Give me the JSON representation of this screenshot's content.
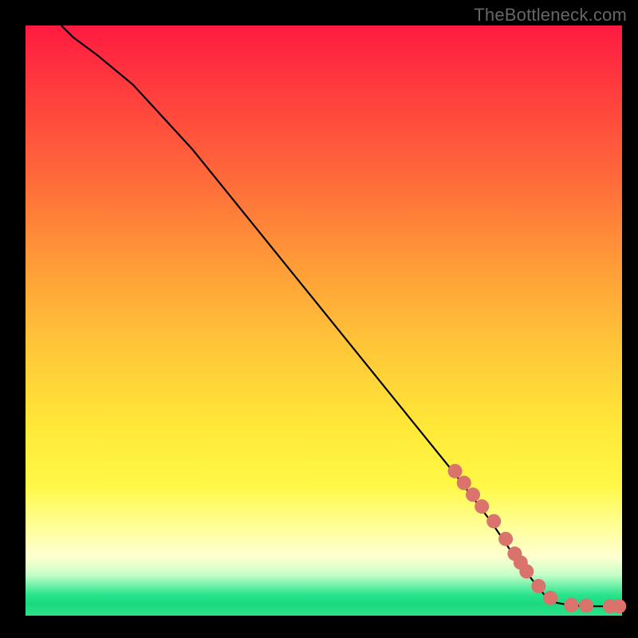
{
  "attribution": "TheBottleneck.com",
  "colors": {
    "marker": "#d9736b",
    "curve": "#000000"
  },
  "chart_data": {
    "type": "line",
    "title": "",
    "xlabel": "",
    "ylabel": "",
    "xlim": [
      0,
      100
    ],
    "ylim": [
      0,
      100
    ],
    "curve": [
      {
        "x": 6,
        "y": 100
      },
      {
        "x": 8,
        "y": 98
      },
      {
        "x": 12,
        "y": 95
      },
      {
        "x": 18,
        "y": 90
      },
      {
        "x": 28,
        "y": 79
      },
      {
        "x": 40,
        "y": 64
      },
      {
        "x": 52,
        "y": 49
      },
      {
        "x": 64,
        "y": 34
      },
      {
        "x": 72,
        "y": 24
      },
      {
        "x": 78,
        "y": 16
      },
      {
        "x": 82,
        "y": 10
      },
      {
        "x": 85,
        "y": 6
      },
      {
        "x": 87,
        "y": 3.5
      },
      {
        "x": 89,
        "y": 2.2
      },
      {
        "x": 91,
        "y": 1.8
      },
      {
        "x": 94,
        "y": 1.6
      },
      {
        "x": 98,
        "y": 1.6
      },
      {
        "x": 100,
        "y": 1.6
      }
    ],
    "markers": [
      {
        "x": 72,
        "y": 24.5
      },
      {
        "x": 73.5,
        "y": 22.5
      },
      {
        "x": 75,
        "y": 20.5
      },
      {
        "x": 76.5,
        "y": 18.5
      },
      {
        "x": 78.5,
        "y": 16
      },
      {
        "x": 80.5,
        "y": 13
      },
      {
        "x": 82,
        "y": 10.5
      },
      {
        "x": 83,
        "y": 9
      },
      {
        "x": 84,
        "y": 7.5
      },
      {
        "x": 86,
        "y": 5
      },
      {
        "x": 88,
        "y": 3
      },
      {
        "x": 91.5,
        "y": 1.8
      },
      {
        "x": 94,
        "y": 1.7
      },
      {
        "x": 98,
        "y": 1.6
      },
      {
        "x": 99.5,
        "y": 1.6
      }
    ]
  }
}
